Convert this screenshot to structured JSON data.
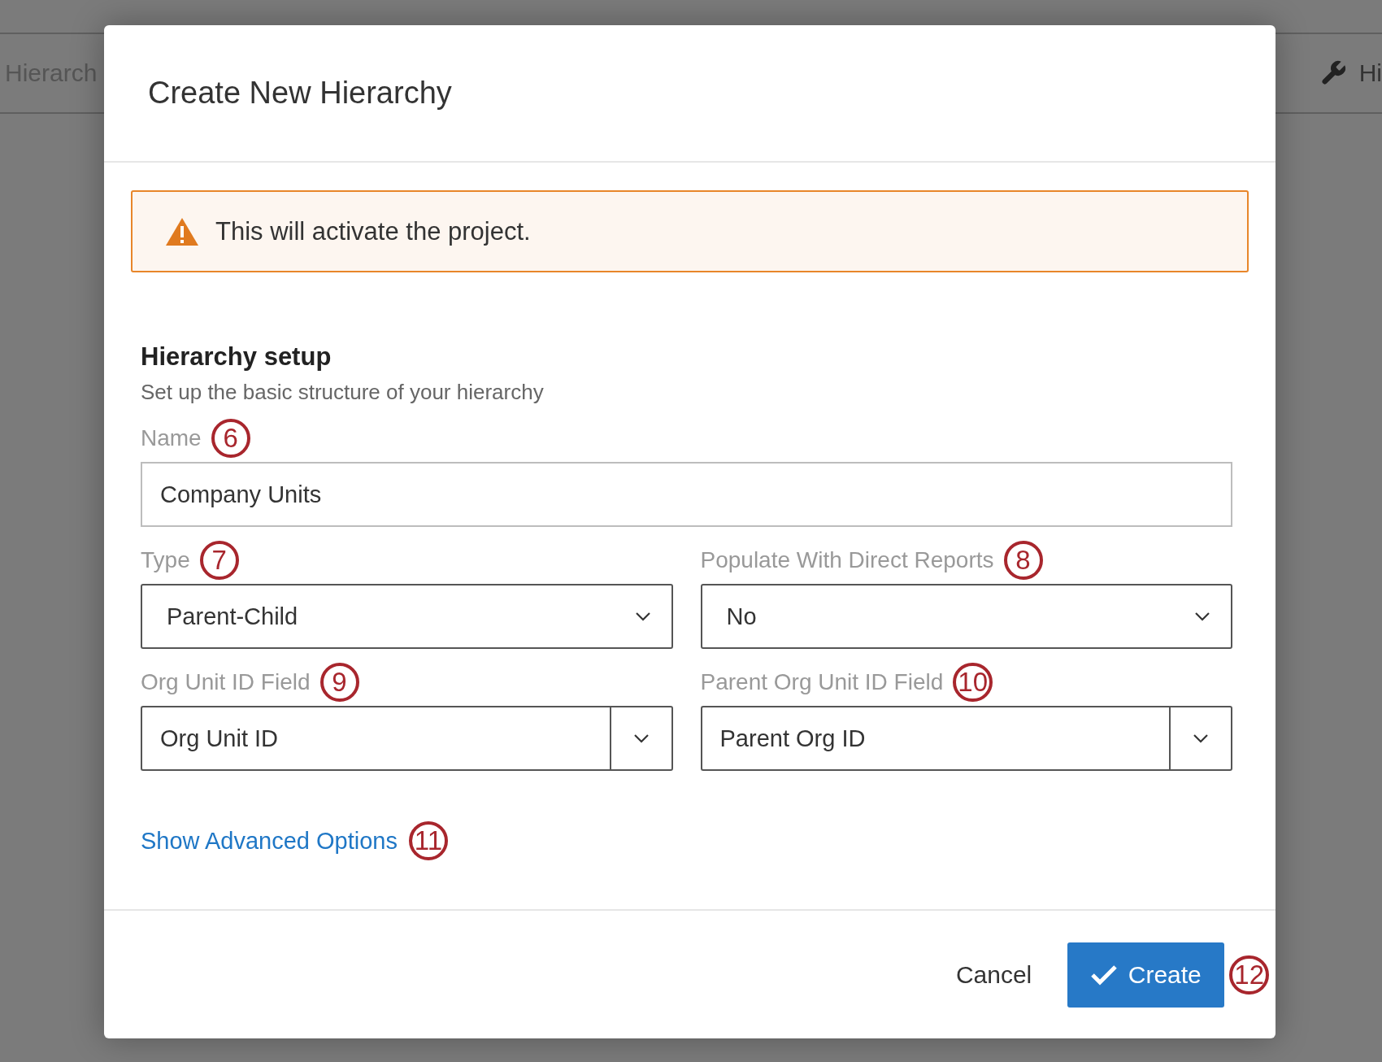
{
  "background": {
    "tab_label": "Hierarch",
    "right_label": "Hi"
  },
  "dialog": {
    "title": "Create New Hierarchy",
    "warning": "This will activate the project.",
    "section": {
      "title": "Hierarchy setup",
      "subtitle": "Set up the basic structure of your hierarchy"
    },
    "name_field": {
      "label": "Name",
      "callout": "6",
      "value": "Company Units"
    },
    "rows": [
      [
        {
          "kind": "select",
          "label": "Type",
          "callout": "7",
          "value": "Parent-Child"
        },
        {
          "kind": "select",
          "label": "Populate With Direct Reports",
          "callout": "8",
          "value": "No"
        }
      ],
      [
        {
          "kind": "combo",
          "label": "Org Unit ID Field",
          "callout": "9",
          "value": "Org Unit ID"
        },
        {
          "kind": "combo",
          "label": "Parent Org Unit ID Field",
          "callout": "10",
          "value": "Parent Org ID"
        }
      ]
    ],
    "advanced_link": {
      "label": "Show Advanced Options",
      "callout": "11"
    },
    "buttons": [
      {
        "kind": "text",
        "label": "Cancel"
      },
      {
        "kind": "primary",
        "label": "Create",
        "callout": "12"
      }
    ]
  }
}
